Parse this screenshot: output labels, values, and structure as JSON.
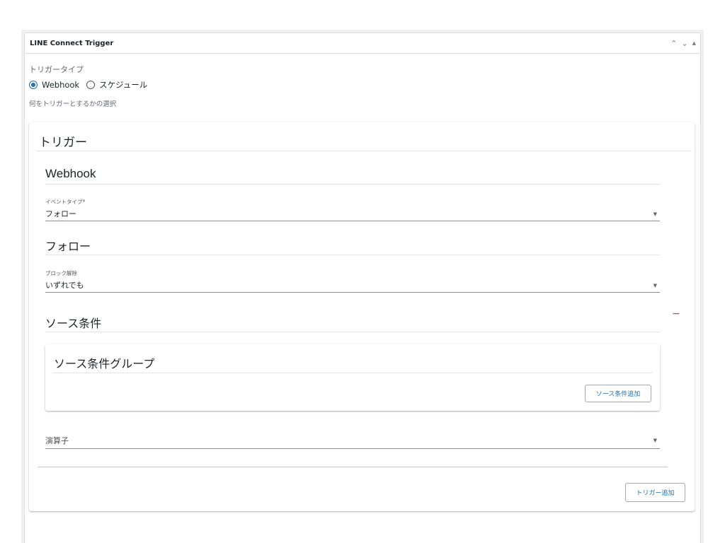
{
  "metabox": {
    "title": "LINE Connect Trigger",
    "controls": {
      "up": "⌃",
      "down": "⌄",
      "toggle": "▲"
    }
  },
  "trigger_type": {
    "label": "トリガータイプ",
    "options": [
      {
        "label": "Webhook",
        "checked": true
      },
      {
        "label": "スケジュール",
        "checked": false
      }
    ],
    "help": "何をトリガーとするかの選択"
  },
  "trigger": {
    "heading": "トリガー",
    "webhook": {
      "heading": "Webhook",
      "event_type_label": "イベントタイプ*",
      "event_type_value": "フォロー"
    },
    "follow": {
      "heading": "フォロー",
      "unblock_label": "ブロック解除",
      "unblock_value": "いずれでも"
    },
    "source": {
      "heading": "ソース条件",
      "remove": "−",
      "group": {
        "heading": "ソース条件グループ",
        "add_button": "ソース条件追加"
      },
      "operator_placeholder": "演算子"
    },
    "add_button": "トリガー追加"
  },
  "colors": {
    "accent": "#2271b1",
    "danger": "#d63638"
  }
}
